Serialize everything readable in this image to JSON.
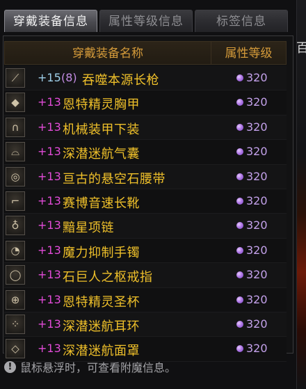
{
  "tabs": [
    {
      "label": "穿戴装备信息",
      "active": true
    },
    {
      "label": "属性等级信息",
      "active": false
    },
    {
      "label": "标签信息",
      "active": false
    }
  ],
  "table": {
    "headers": {
      "name": "穿戴装备名称",
      "level": "属性等级"
    },
    "rows": [
      {
        "icon": "sword-icon",
        "glyph": "⟋",
        "enhance": "+15",
        "enchant": "(8)",
        "name": "吞噬本源长枪",
        "level": "320"
      },
      {
        "icon": "chest-armor-icon",
        "glyph": "◆",
        "enhance": "+13",
        "enchant": "",
        "name": "恩特精灵胸甲",
        "level": "320"
      },
      {
        "icon": "leg-armor-icon",
        "glyph": "∩",
        "enhance": "+13",
        "enchant": "",
        "name": "机械装甲下装",
        "level": "320"
      },
      {
        "icon": "shoulder-icon",
        "glyph": "⌓",
        "enhance": "+13",
        "enchant": "",
        "name": "深潜迷航气囊",
        "level": "320"
      },
      {
        "icon": "belt-icon",
        "glyph": "◎",
        "enhance": "+13",
        "enchant": "",
        "name": "亘古的悬空石腰带",
        "level": "320"
      },
      {
        "icon": "boots-icon",
        "glyph": "⌐",
        "enhance": "+13",
        "enchant": "",
        "name": "赛博音速长靴",
        "level": "320"
      },
      {
        "icon": "necklace-icon",
        "glyph": "♁",
        "enhance": "+13",
        "enchant": "",
        "name": "黯星项链",
        "level": "320"
      },
      {
        "icon": "bracelet-icon",
        "glyph": "◔",
        "enhance": "+13",
        "enchant": "",
        "name": "魔力抑制手镯",
        "level": "320"
      },
      {
        "icon": "ring-icon",
        "glyph": "◯",
        "enhance": "+13",
        "enchant": "",
        "name": "石巨人之枢戒指",
        "level": "320"
      },
      {
        "icon": "sub-equipment-icon",
        "glyph": "⊕",
        "enhance": "+13",
        "enchant": "",
        "name": "恩特精灵圣杯",
        "level": "320"
      },
      {
        "icon": "earring-icon",
        "glyph": "⁘",
        "enhance": "+13",
        "enchant": "",
        "name": "深潜迷航耳环",
        "level": "320"
      },
      {
        "icon": "magic-stone-icon",
        "glyph": "◇",
        "enhance": "+13",
        "enchant": "",
        "name": "深潜迷航面罩",
        "level": "320"
      }
    ]
  },
  "footer": {
    "icon": "info-icon",
    "glyph": "!",
    "text": "鼠标悬浮时，可查看附魔信息。"
  },
  "colors": {
    "enhance_15": "#9fd0ea",
    "enhance_13": "#e24bd8",
    "item_name": "#efc02a",
    "level": "#c3a1ea",
    "header": "#d59b3a"
  }
}
